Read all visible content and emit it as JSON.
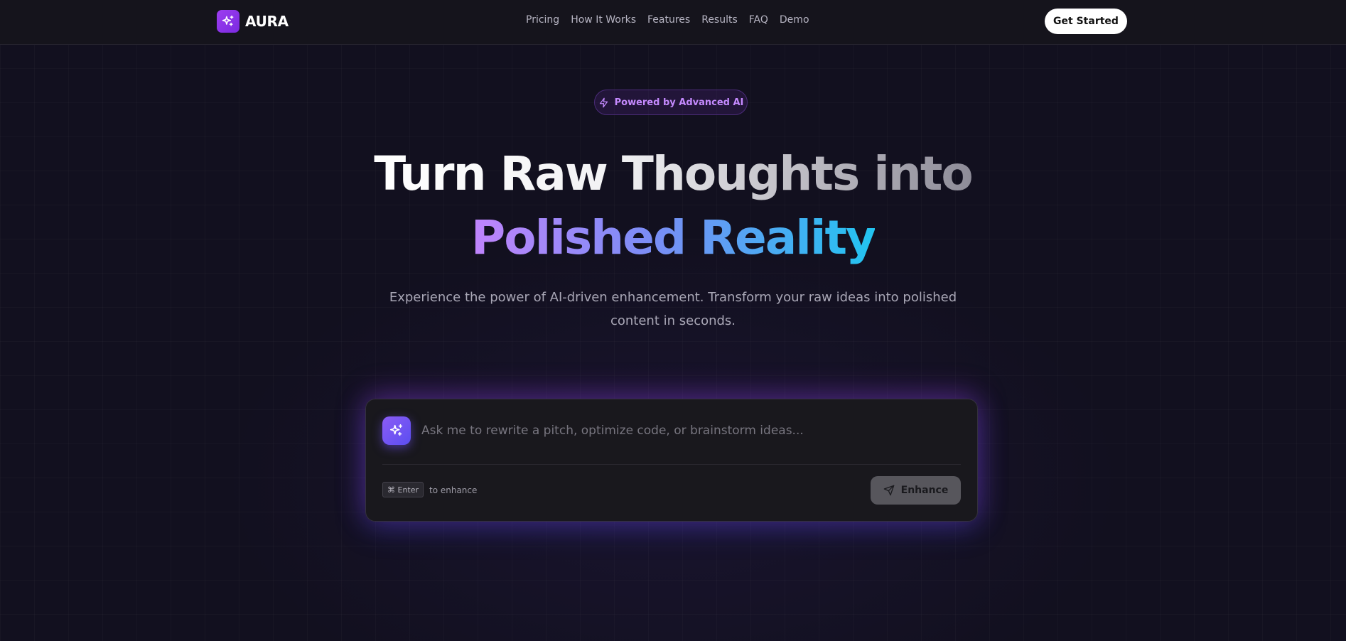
{
  "header": {
    "brand": "AURA",
    "nav_links": [
      "Pricing",
      "How It Works",
      "Features",
      "Results",
      "FAQ",
      "Demo"
    ],
    "cta_label": "Get Started"
  },
  "hero": {
    "badge": "Powered by Advanced AI",
    "headline_line1": "Turn Raw Thoughts into",
    "headline_line2": "Polished Reality",
    "subtitle": "Experience the power of AI-driven enhancement. Transform your raw ideas into polished content in seconds."
  },
  "prompt": {
    "placeholder": "Ask me to rewrite a pitch, optimize code, or brainstorm ideas...",
    "value": "",
    "shortcut_key": "⌘ Enter",
    "shortcut_hint": "to enhance",
    "submit_label": "Enhance"
  },
  "icons": {
    "brand": "sparkles-icon",
    "badge": "lightning-icon",
    "prompt": "sparkles-icon",
    "submit": "send-icon"
  },
  "colors": {
    "brand_accent": "#9d3df0",
    "badge_text": "#c58aff",
    "headline_gradient_start": "#c084fc",
    "headline_gradient_end": "#22c4f0",
    "background": "#12101f"
  }
}
